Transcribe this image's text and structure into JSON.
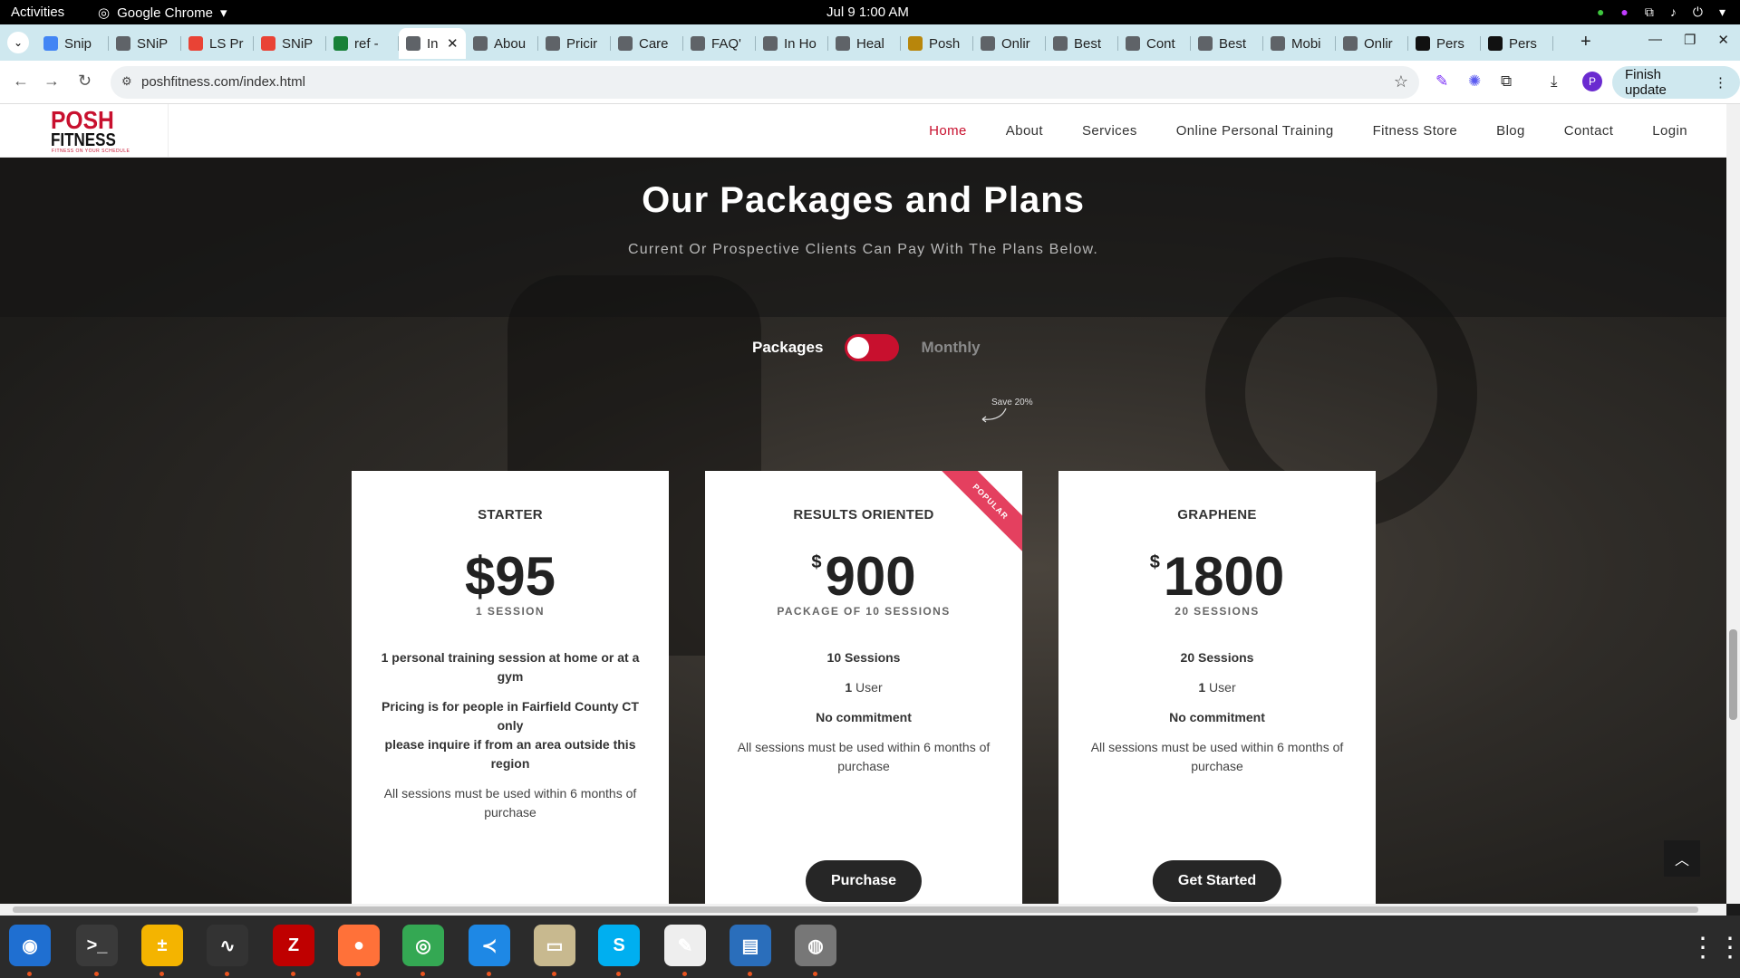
{
  "system": {
    "activities": "Activities",
    "app_name": "Google Chrome",
    "clock": "Jul 9  1:00 AM"
  },
  "tabs": [
    {
      "label": "Snip",
      "color": "#4285f4"
    },
    {
      "label": "SNiP",
      "color": "#5f6368"
    },
    {
      "label": "LS Pr",
      "color": "#e94335"
    },
    {
      "label": "SNiP",
      "color": "#e94335"
    },
    {
      "label": "ref -",
      "color": "#188038"
    },
    {
      "label": "In",
      "color": "#5f6368",
      "active": true
    },
    {
      "label": "Abou",
      "color": "#5f6368"
    },
    {
      "label": "Pricir",
      "color": "#5f6368"
    },
    {
      "label": "Care",
      "color": "#5f6368"
    },
    {
      "label": "FAQ'",
      "color": "#5f6368"
    },
    {
      "label": "In Ho",
      "color": "#5f6368"
    },
    {
      "label": "Heal",
      "color": "#5f6368"
    },
    {
      "label": "Posh",
      "color": "#b8860b"
    },
    {
      "label": "Onlir",
      "color": "#5f6368"
    },
    {
      "label": "Best",
      "color": "#5f6368"
    },
    {
      "label": "Cont",
      "color": "#5f6368"
    },
    {
      "label": "Best",
      "color": "#5f6368"
    },
    {
      "label": "Mobi",
      "color": "#5f6368"
    },
    {
      "label": "Onlir",
      "color": "#5f6368"
    },
    {
      "label": "Pers",
      "color": "#111111"
    },
    {
      "label": "Pers",
      "color": "#111111"
    }
  ],
  "toolbar": {
    "url": "poshfitness.com/index.html",
    "finish_update": "Finish update",
    "profile_initial": "P"
  },
  "site": {
    "logo_top": "POSH",
    "logo_bottom": "FITNESS",
    "logo_tagline": "FITNESS ON YOUR SCHEDULE",
    "nav": [
      "Home",
      "About",
      "Services",
      "Online Personal Training",
      "Fitness Store",
      "Blog",
      "Contact",
      "Login"
    ]
  },
  "section": {
    "title": "Our Packages and Plans",
    "subtitle": "Current Or Prospective Clients Can Pay With The Plans Below.",
    "toggle_left": "Packages",
    "toggle_right": "Monthly",
    "save_note": "Save 20%"
  },
  "plans": [
    {
      "name": "STARTER",
      "currency": "",
      "price": "$95",
      "unit": "1 SESSION",
      "features": [
        {
          "bold": "1 personal training session at home or at a gym",
          "text": ""
        },
        {
          "bold": "Pricing is for people in Fairfield County CT only\nplease inquire if from an area outside this region",
          "text": ""
        },
        {
          "bold": "",
          "text": "All sessions must be used within 6 months of purchase"
        }
      ],
      "button": "",
      "popular": ""
    },
    {
      "name": "RESULTS ORIENTED",
      "currency": "$",
      "price": "900",
      "unit": "PACKAGE OF 10 SESSIONS",
      "features": [
        {
          "bold": "10 Sessions",
          "text": ""
        },
        {
          "bold": "1",
          "text": " User"
        },
        {
          "bold": "No commitment",
          "text": ""
        },
        {
          "bold": "",
          "text": "All sessions must be used within 6 months of purchase"
        }
      ],
      "button": "Purchase",
      "popular": "POPULAR"
    },
    {
      "name": "GRAPHENE",
      "currency": "$",
      "price": "1800",
      "unit": "20 SESSIONS",
      "features": [
        {
          "bold": "20 Sessions",
          "text": ""
        },
        {
          "bold": "1",
          "text": " User"
        },
        {
          "bold": "No commitment",
          "text": ""
        },
        {
          "bold": "",
          "text": "All sessions must be used within 6 months of purchase"
        }
      ],
      "button": "Get Started",
      "popular": ""
    }
  ],
  "dock": [
    {
      "name": "thunderbird",
      "color": "#1f6fd1",
      "glyph": "◉"
    },
    {
      "name": "terminal",
      "color": "#3a3a3a",
      "glyph": ">_"
    },
    {
      "name": "calculator",
      "color": "#f4b400",
      "glyph": "±"
    },
    {
      "name": "system-monitor",
      "color": "#333333",
      "glyph": "∿"
    },
    {
      "name": "filezilla",
      "color": "#bf0000",
      "glyph": "Z"
    },
    {
      "name": "firefox",
      "color": "#ff7139",
      "glyph": "●"
    },
    {
      "name": "chrome",
      "color": "#34a853",
      "glyph": "◎"
    },
    {
      "name": "vscode",
      "color": "#1e88e5",
      "glyph": "≺"
    },
    {
      "name": "files",
      "color": "#c8b98f",
      "glyph": "▭"
    },
    {
      "name": "skype",
      "color": "#00aff0",
      "glyph": "S"
    },
    {
      "name": "text-editor",
      "color": "#eeeeee",
      "glyph": "✎"
    },
    {
      "name": "writer",
      "color": "#2a6ebb",
      "glyph": "▤"
    },
    {
      "name": "disk",
      "color": "#777777",
      "glyph": "◍"
    }
  ]
}
